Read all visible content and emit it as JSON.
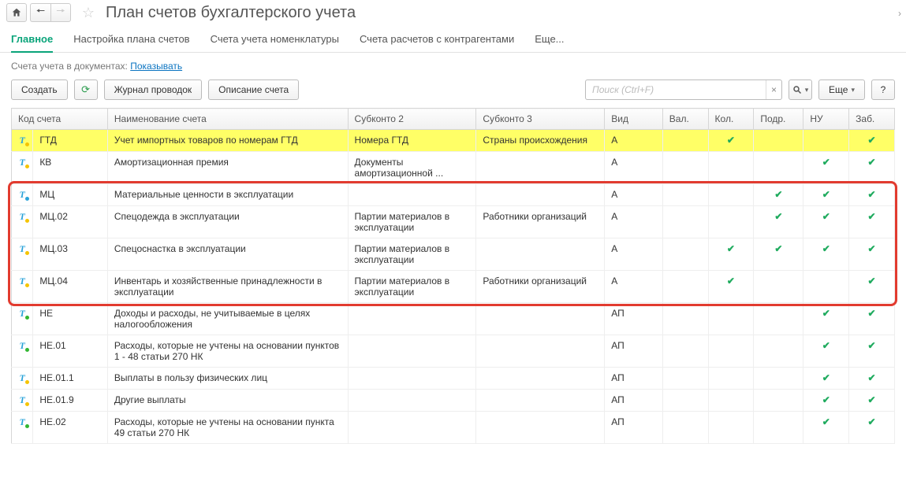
{
  "titlebar": {
    "title": "План счетов бухгалтерского учета"
  },
  "tabs": {
    "items": [
      {
        "label": "Главное",
        "active": true
      },
      {
        "label": "Настройка плана счетов",
        "active": false
      },
      {
        "label": "Счета учета номенклатуры",
        "active": false
      },
      {
        "label": "Счета расчетов с контрагентами",
        "active": false
      },
      {
        "label": "Еще...",
        "active": false
      }
    ]
  },
  "subline": {
    "prefix": "Счета учета в документах: ",
    "link": "Показывать"
  },
  "toolbar": {
    "create": "Создать",
    "journal": "Журнал проводок",
    "describe": "Описание счета",
    "search_placeholder": "Поиск (Ctrl+F)",
    "more": "Еще",
    "help": "?"
  },
  "table": {
    "headers": {
      "code": "Код счета",
      "name": "Наименование счета",
      "sub2": "Субконто 2",
      "sub3": "Субконто 3",
      "vid": "Вид",
      "val": "Вал.",
      "kol": "Кол.",
      "podr": "Подр.",
      "nu": "НУ",
      "zab": "Заб."
    },
    "rows": [
      {
        "icon": "y",
        "code": "ГТД",
        "name": "Учет импортных товаров по номерам ГТД",
        "sub2": "Номера ГТД",
        "sub3": "Страны происхождения",
        "vid": "А",
        "kol": true,
        "nu": false,
        "podr": false,
        "zab": true,
        "sel": true
      },
      {
        "icon": "y",
        "code": "КВ",
        "name": "Амортизационная премия",
        "sub2": "Документы амортизационной ...",
        "sub3": "",
        "vid": "А",
        "nu": true,
        "zab": true
      },
      {
        "icon": "b",
        "code": "МЦ",
        "name": "Материальные ценности в эксплуатации",
        "sub2": "",
        "sub3": "",
        "vid": "А",
        "podr": true,
        "nu": true,
        "zab": true,
        "hl": true
      },
      {
        "icon": "y",
        "code": "МЦ.02",
        "name": "Спецодежда в эксплуатации",
        "sub2": "Партии материалов в эксплуатации",
        "sub3": "Работники организаций",
        "vid": "А",
        "podr": true,
        "nu": true,
        "zab": true,
        "hl": true
      },
      {
        "icon": "y",
        "code": "МЦ.03",
        "name": "Спецоснастка в эксплуатации",
        "sub2": "Партии материалов в эксплуатации",
        "sub3": "",
        "vid": "А",
        "kol": true,
        "podr": true,
        "nu": true,
        "zab": true,
        "hl": true
      },
      {
        "icon": "y",
        "code": "МЦ.04",
        "name": "Инвентарь и хозяйственные принадлежности в эксплуатации",
        "sub2": "Партии материалов в эксплуатации",
        "sub3": "Работники организаций",
        "vid": "А",
        "kol": true,
        "podr": false,
        "nu": false,
        "zab": true,
        "hl": true
      },
      {
        "icon": "g",
        "code": "НЕ",
        "name": "Доходы и расходы, не учитываемые в целях налогообложения",
        "sub2": "",
        "sub3": "",
        "vid": "АП",
        "nu": true,
        "zab": true
      },
      {
        "icon": "g",
        "code": "НЕ.01",
        "name": "Расходы, которые не учтены на основании пунктов 1 - 48 статьи 270 НК",
        "sub2": "",
        "sub3": "",
        "vid": "АП",
        "nu": true,
        "zab": true
      },
      {
        "icon": "y",
        "code": "НЕ.01.1",
        "name": "Выплаты в пользу физических лиц",
        "sub2": "",
        "sub3": "",
        "vid": "АП",
        "nu": true,
        "zab": true
      },
      {
        "icon": "y",
        "code": "НЕ.01.9",
        "name": "Другие выплаты",
        "sub2": "",
        "sub3": "",
        "vid": "АП",
        "nu": true,
        "zab": true
      },
      {
        "icon": "g",
        "code": "НЕ.02",
        "name": "Расходы, которые не учтены на основании пункта 49 статьи 270 НК",
        "sub2": "",
        "sub3": "",
        "vid": "АП",
        "nu": true,
        "zab": true
      }
    ]
  }
}
